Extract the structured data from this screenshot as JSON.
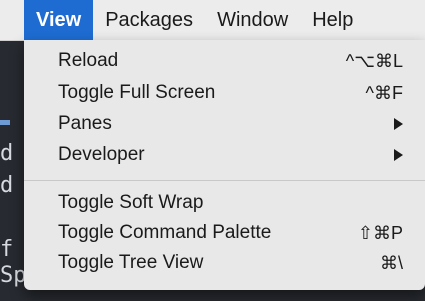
{
  "menubar": {
    "items": [
      {
        "label": "View",
        "active": true
      },
      {
        "label": "Packages"
      },
      {
        "label": "Window"
      },
      {
        "label": "Help"
      }
    ]
  },
  "menu": {
    "items": [
      {
        "label": "Reload",
        "shortcut": "^⌥⌘L"
      },
      {
        "label": "Toggle Full Screen",
        "shortcut": "^⌘F"
      },
      {
        "label": "Panes",
        "submenu": true
      },
      {
        "label": "Developer",
        "submenu": true
      },
      {
        "label": "Toggle Soft Wrap",
        "shortcut": ""
      },
      {
        "label": "Toggle Command Palette",
        "shortcut": "⇧⌘P"
      },
      {
        "label": "Toggle Tree View",
        "shortcut": "⌘\\"
      }
    ]
  },
  "editor": {
    "lines": [
      "d",
      "d",
      "f",
      "Speed() ."
    ]
  },
  "colors": {
    "accent": "#1e6cd2",
    "menu_bg": "#e8e8e8",
    "editor_bg": "#272a30"
  }
}
